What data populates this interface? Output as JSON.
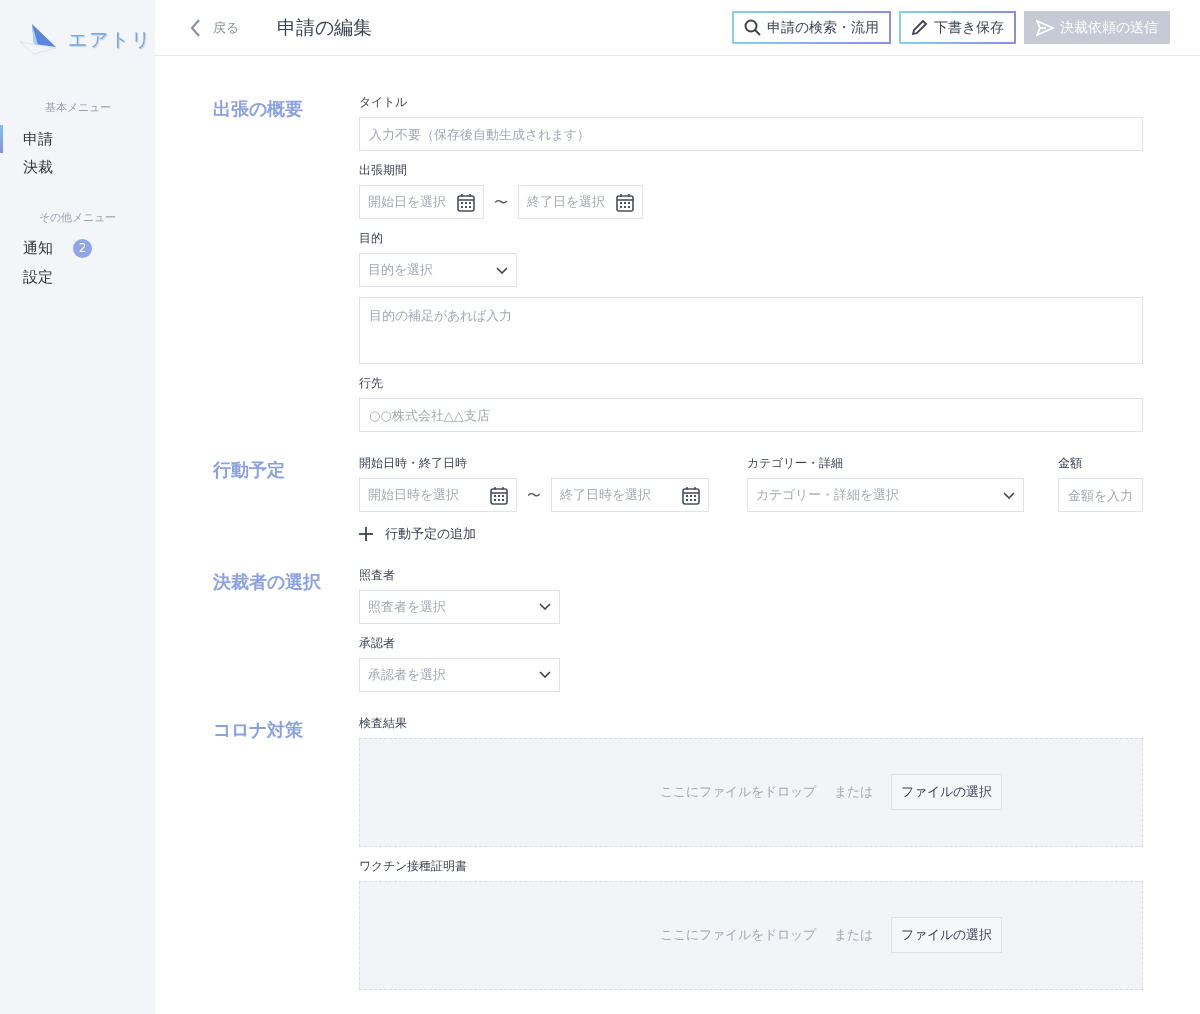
{
  "app": {
    "logo_text": "エアトリ"
  },
  "sidebar": {
    "groups": [
      {
        "heading": "基本メニュー",
        "items": [
          {
            "label": "申請",
            "selected": true
          },
          {
            "label": "決裁",
            "selected": false
          }
        ]
      },
      {
        "heading": "その他メニュー",
        "items": [
          {
            "label": "通知",
            "selected": false,
            "badge": "2"
          },
          {
            "label": "設定",
            "selected": false
          }
        ]
      }
    ]
  },
  "header": {
    "back": "戻る",
    "title": "申請の編集",
    "buttons": [
      {
        "label": "申請の検索・流用",
        "kind": "search",
        "disabled": false
      },
      {
        "label": "下書き保存",
        "kind": "draft",
        "disabled": false
      },
      {
        "label": "決裁依頼の送信",
        "kind": "submit",
        "disabled": true
      }
    ]
  },
  "sections": [
    {
      "title": "出張の概要",
      "kind": "stack",
      "fields": [
        {
          "kind": "text",
          "label": "タイトル",
          "placeholder": "入力不要（保存後自動生成されます）"
        },
        {
          "kind": "date-range",
          "label": "出張期間",
          "start_placeholder": "開始日を選択",
          "separator": "〜",
          "end_placeholder": "終了日を選択"
        },
        {
          "kind": "select",
          "label": "目的",
          "placeholder": "目的を選択"
        },
        {
          "kind": "textarea",
          "placeholder": "目的の補足があれば入力"
        },
        {
          "kind": "text",
          "label": "行先",
          "placeholder": "○○株式会社△△支店"
        }
      ]
    },
    {
      "title": "行動予定",
      "kind": "row",
      "fields": [
        {
          "kind": "date-range",
          "label": "開始日時・終了日時",
          "start_placeholder": "開始日時を選択",
          "separator": "〜",
          "end_placeholder": "終了日時を選択"
        },
        {
          "kind": "select",
          "label": "カテゴリー・詳細",
          "placeholder": "カテゴリー・詳細を選択"
        },
        {
          "kind": "text",
          "label": "金額",
          "placeholder": "金額を入力"
        }
      ],
      "add_button": "行動予定の追加"
    },
    {
      "title": "決裁者の選択",
      "kind": "stack",
      "fields": [
        {
          "kind": "select",
          "label": "照査者",
          "placeholder": "照査者を選択"
        },
        {
          "kind": "select",
          "label": "承認者",
          "placeholder": "承認者を選択"
        }
      ]
    },
    {
      "title": "コロナ対策",
      "kind": "stack",
      "fields": [
        {
          "kind": "dropzone",
          "label": "検査結果",
          "hint": "ここにファイルをドロップ",
          "or": "または",
          "button": "ファイルの選択"
        },
        {
          "kind": "dropzone",
          "label": "ワクチン接種証明書",
          "hint": "ここにファイルをドロップ",
          "or": "または",
          "button": "ファイルの選択"
        }
      ]
    }
  ]
}
